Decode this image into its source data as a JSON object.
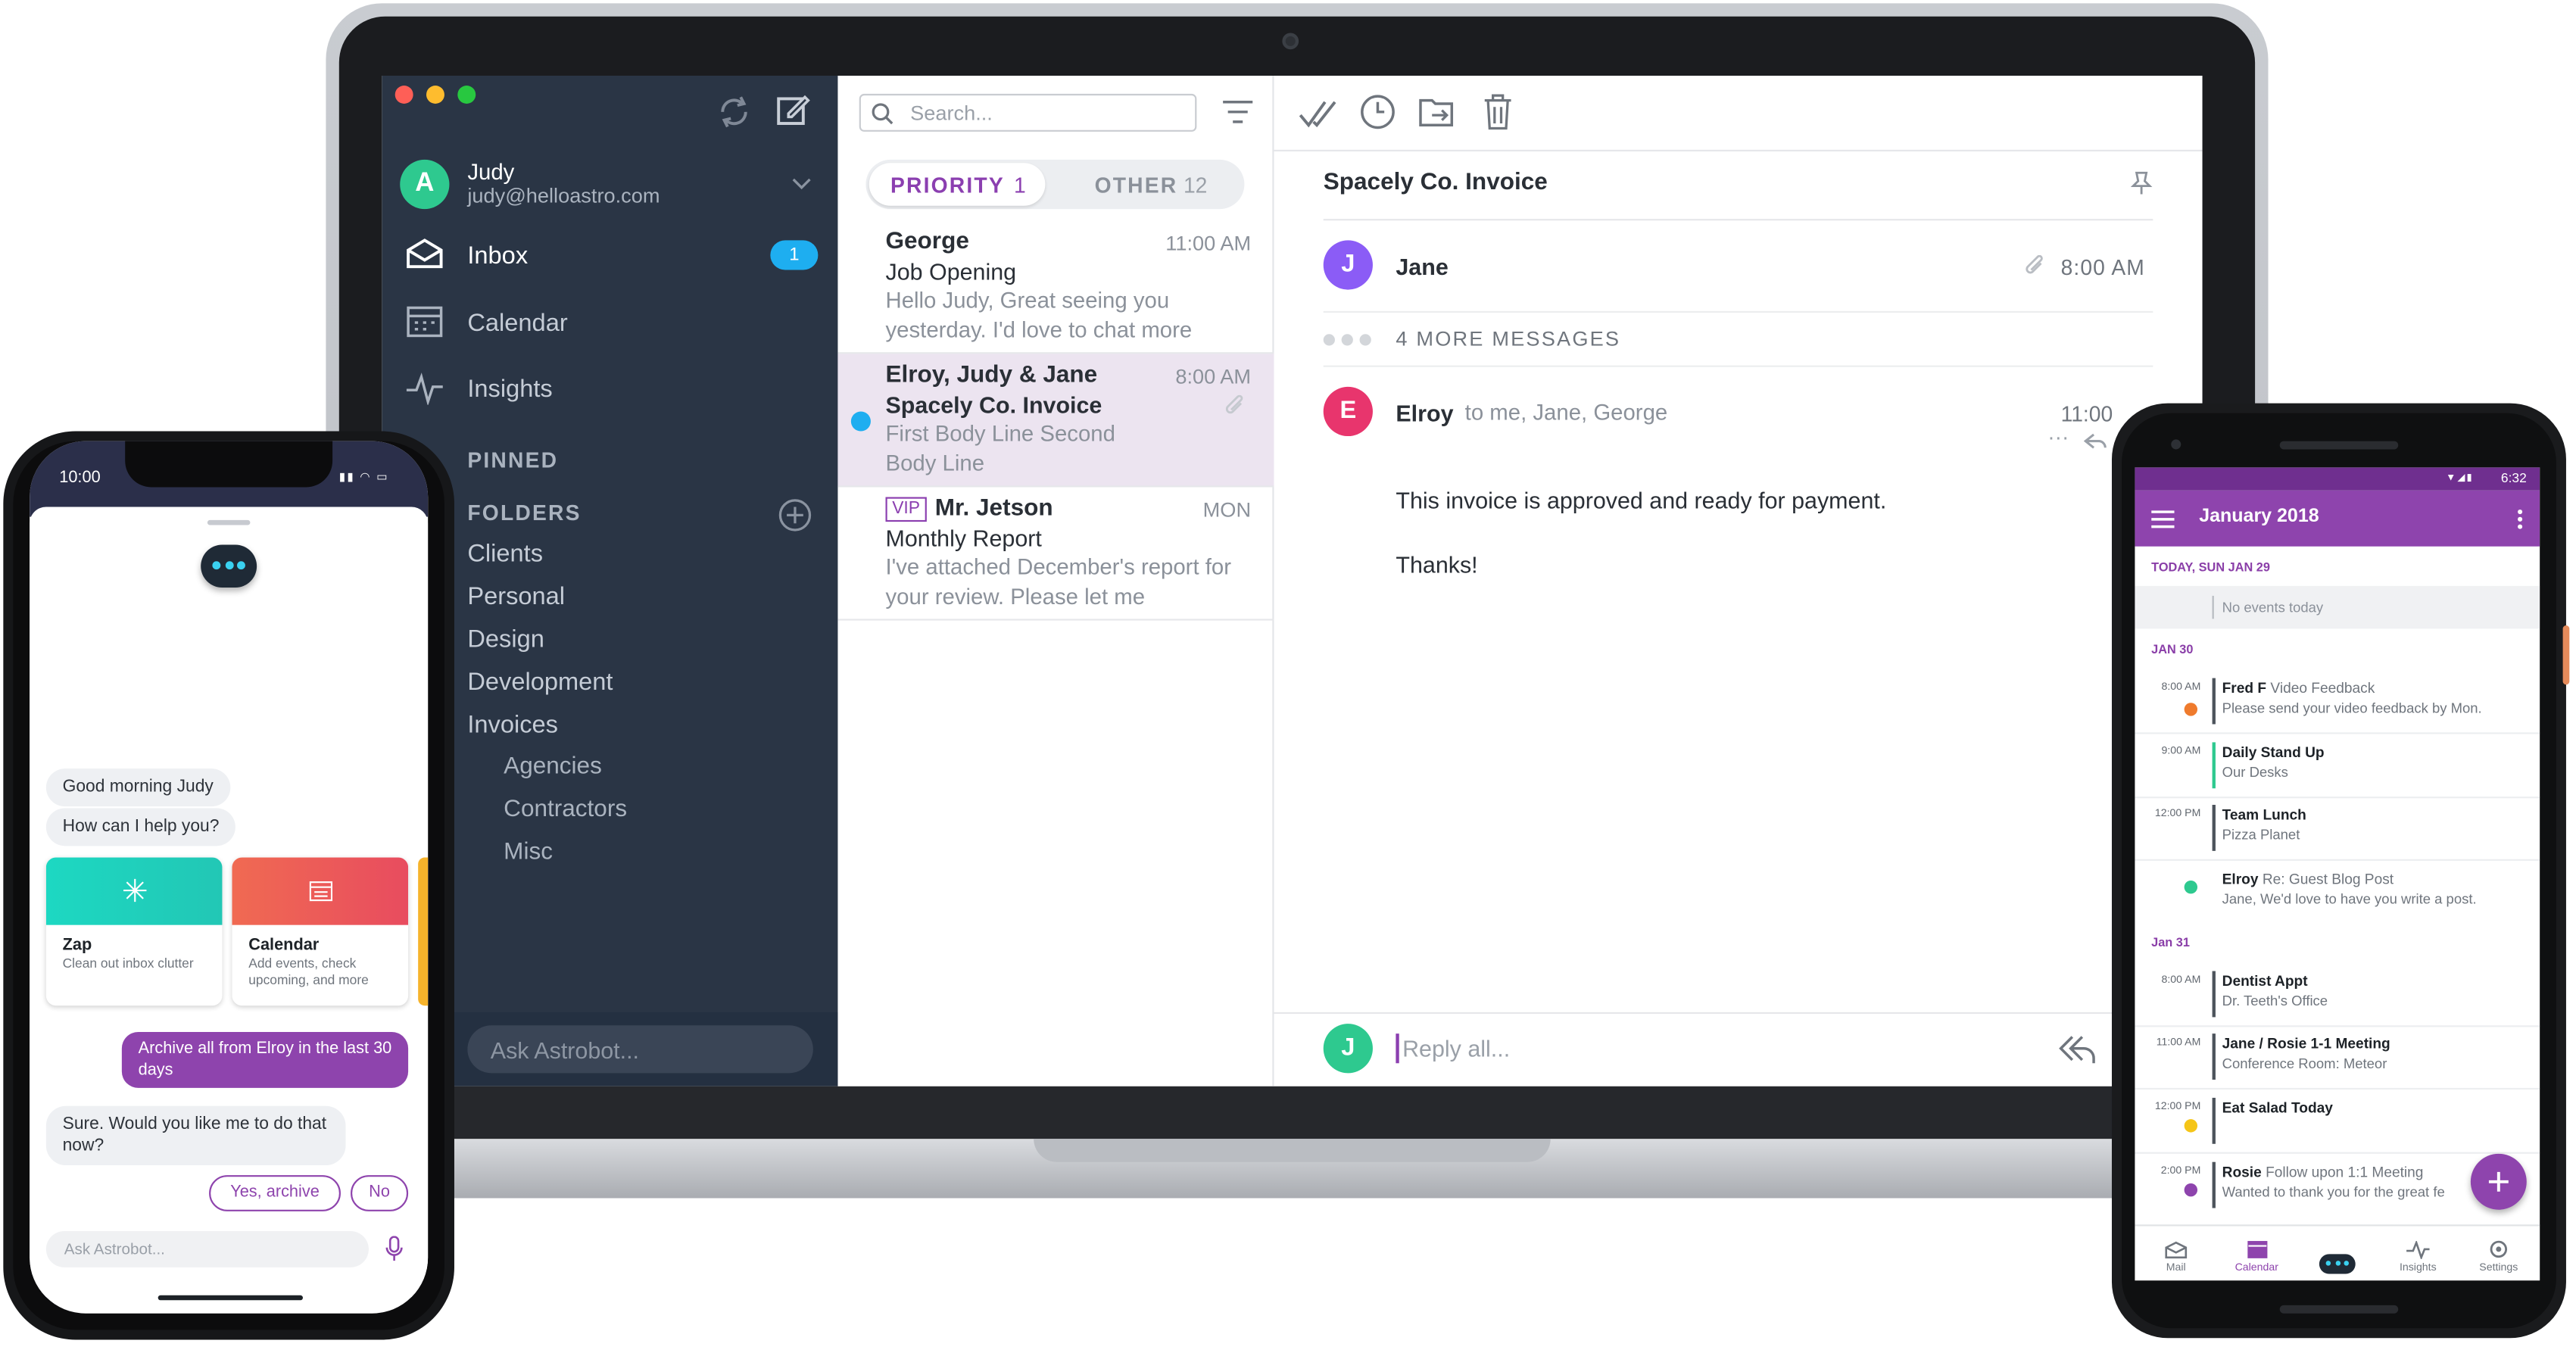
{
  "laptop": {
    "account": {
      "initial": "A",
      "name": "Judy",
      "email": "judy@helloastro.com"
    },
    "nav": [
      {
        "label": "Inbox",
        "badge": "1"
      },
      {
        "label": "Calendar"
      },
      {
        "label": "Insights"
      }
    ],
    "pinned_label": "PINNED",
    "folders_label": "FOLDERS",
    "folders": [
      "Clients",
      "Personal",
      "Design",
      "Development",
      "Invoices"
    ],
    "subfolders": [
      "Agencies",
      "Contractors",
      "Misc"
    ],
    "ask_placeholder": "Ask Astrobot...",
    "search_placeholder": "Search...",
    "tabs": {
      "priority_label": "PRIORITY",
      "priority_count": "1",
      "other_label": "OTHER",
      "other_count": "12"
    },
    "messages": [
      {
        "from": "George",
        "subject": "Job Opening",
        "preview": "Hello Judy, Great seeing you yesterday. I'd love to chat more",
        "time": "11:00 AM"
      },
      {
        "from": "Elroy, Judy & Jane",
        "subject": "Spacely Co. Invoice",
        "preview": "First Body Line Second Body Line",
        "time": "8:00 AM"
      },
      {
        "vip": "VIP",
        "from": "Mr. Jetson",
        "subject": "Monthly Report",
        "preview": "I've attached December's report for your review. Please let me",
        "time": "MON"
      }
    ],
    "reader": {
      "subject": "Spacely Co. Invoice",
      "first": {
        "initial": "J",
        "name": "Jane",
        "time": "8:00 AM"
      },
      "more": "4 MORE MESSAGES",
      "current": {
        "initial": "E",
        "name": "Elroy",
        "to": "to me, Jane, George",
        "time": "11:00"
      },
      "body1": "This invoice is approved and ready for payment.",
      "body2": "Thanks!",
      "reply_initial": "J",
      "reply_placeholder": "Reply all..."
    }
  },
  "iphone": {
    "time": "10:00",
    "bot_greeting": "Good morning Judy",
    "bot_question": "How can I help you?",
    "cards": [
      {
        "title": "Zap",
        "desc": "Clean out inbox clutter"
      },
      {
        "title": "Calendar",
        "desc": "Add events, check upcoming, and more"
      }
    ],
    "user_msg": "Archive all from Elroy in the last 30 days",
    "bot_reply": "Sure. Would you like me to do that now?",
    "yes_label": "Yes, archive",
    "no_label": "No",
    "ask_placeholder": "Ask Astrobot..."
  },
  "android": {
    "time": "6:32",
    "title": "January 2018",
    "today_label": "TODAY, SUN JAN 29",
    "no_events": "No events today",
    "day2": "JAN 30",
    "day3": "Jan 31",
    "events_jan30": [
      {
        "time": "8:00 AM",
        "name": "Fred F",
        "extra": "Video Feedback",
        "desc": "Please send your video feedback by Mon."
      },
      {
        "time": "9:00 AM",
        "name": "Daily Stand Up",
        "extra": "",
        "desc": "Our Desks"
      },
      {
        "time": "12:00 PM",
        "name": "Team Lunch",
        "extra": "",
        "desc": "Pizza Planet"
      },
      {
        "time": "",
        "name": "Elroy",
        "extra": "Re: Guest Blog Post",
        "desc": "Jane, We'd love to have you write a post."
      }
    ],
    "events_jan31": [
      {
        "time": "8:00 AM",
        "name": "Dentist Appt",
        "extra": "",
        "desc": "Dr. Teeth's Office"
      },
      {
        "time": "11:00 AM",
        "name": "Jane / Rosie 1-1 Meeting",
        "extra": "",
        "desc": "Conference Room: Meteor"
      },
      {
        "time": "12:00 PM",
        "name": "Eat Salad Today",
        "extra": "",
        "desc": ""
      },
      {
        "time": "2:00 PM",
        "name": "Rosie",
        "extra": "Follow upon 1:1 Meeting",
        "desc": "Wanted to thank you for the great fe"
      }
    ],
    "tabbar": [
      "Mail",
      "Calendar",
      "",
      "Insights",
      "Settings"
    ],
    "colors": {
      "accent": "#8e44ad",
      "priority": "#8b3fb0",
      "unread": "#1eaef0"
    }
  }
}
